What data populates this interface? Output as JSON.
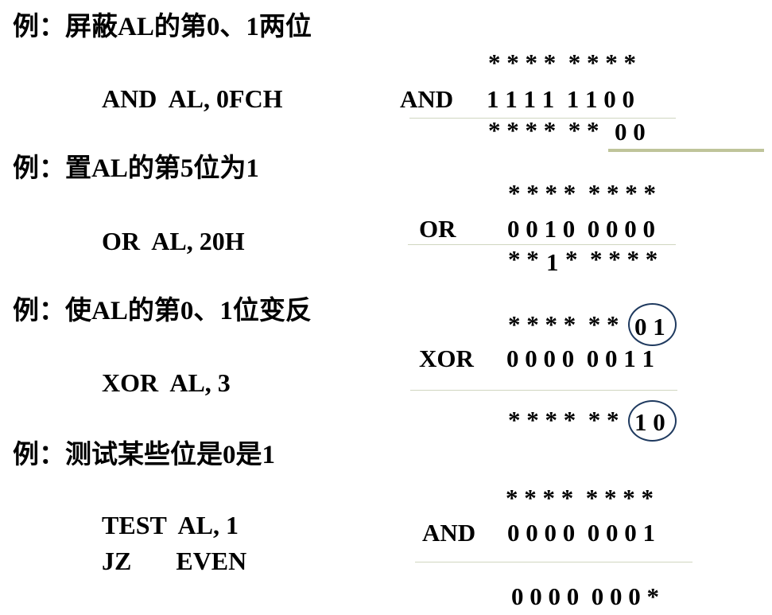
{
  "colors": {
    "text": "#000000",
    "rule": "#d0d6c0",
    "accent_bar": "#bfc49a",
    "circle": "#1f3a5f"
  },
  "ex1": {
    "heading": "例：屏蔽AL的第0、1两位",
    "code": "AND  AL, 0FCH",
    "pattern": "* * * *  * * * *",
    "op": "AND",
    "operand": "1 1 1 1  1 1 0 0",
    "result_stars": "* * * *  * *",
    "result_bits": "0 0"
  },
  "ex2": {
    "heading": "例：置AL的第5位为1",
    "code": "OR  AL, 20H",
    "pattern": "* * * *  * * * *",
    "op": "OR",
    "operand": "0 0 1 0  0 0 0 0",
    "result_a": "* *",
    "result_one": "1",
    "result_b": "*  * * * *"
  },
  "ex3": {
    "heading": "例：使AL的第0、1位变反",
    "code": "XOR  AL, 3",
    "pattern_stars": "* * * *  * *",
    "pattern_bits": "0 1",
    "op": "XOR",
    "operand": "0 0 0 0  0 0 1 1",
    "result_stars": "* * * *  * *",
    "result_bits": "1 0"
  },
  "ex4": {
    "heading": "例：测试某些位是0是1",
    "code_1": "TEST  AL, 1",
    "code_2": "JZ       EVEN",
    "pattern": "* * * *  * * * *",
    "op": "AND",
    "operand": "0 0 0 0  0 0 0 1",
    "result": "0 0 0 0  0 0 0 *"
  }
}
